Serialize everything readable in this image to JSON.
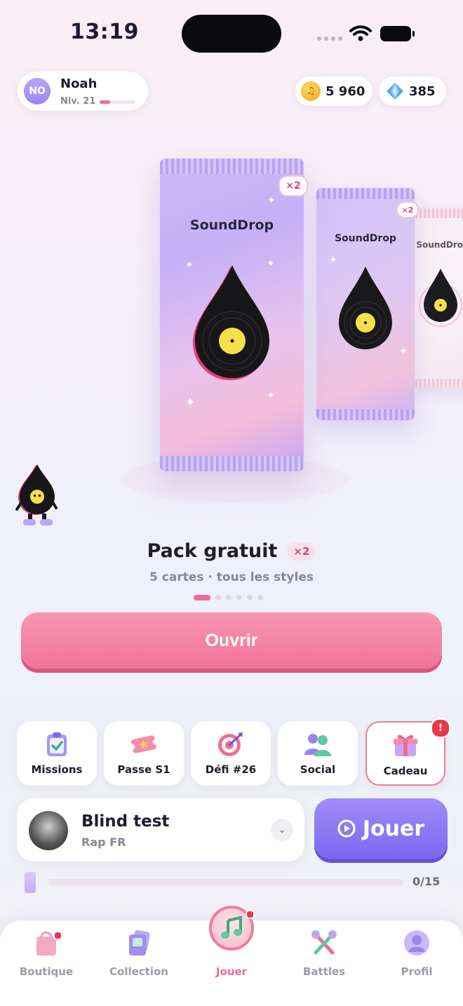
{
  "status": {
    "time": "13:19"
  },
  "user": {
    "initials": "NO",
    "name": "Noah",
    "level": "Niv. 21",
    "xp_fraction": 0.3
  },
  "currency": {
    "coins": "5 960",
    "gems": "385"
  },
  "pack": {
    "brand": "SoundDrop",
    "multiplier": "×2",
    "title": "Pack gratuit",
    "subtitle": "5 cartes · tous les styles",
    "pages": 6,
    "active_page": 0,
    "open_label": "Ouvrir"
  },
  "tiles": [
    {
      "label": "Missions",
      "icon": "clipboard-check-icon"
    },
    {
      "label": "Passe S1",
      "icon": "ticket-icon"
    },
    {
      "label": "Défi #26",
      "icon": "target-icon"
    },
    {
      "label": "Social",
      "icon": "people-icon"
    },
    {
      "label": "Cadeau",
      "icon": "gift-icon",
      "alert": "!"
    }
  ],
  "blind_test": {
    "title": "Blind test",
    "subtitle": "Rap FR",
    "play_label": "Jouer"
  },
  "progress": {
    "text": "0/15",
    "fraction": 0
  },
  "nav": [
    {
      "label": "Boutique",
      "icon": "shopping-bag-icon"
    },
    {
      "label": "Collection",
      "icon": "cards-icon"
    },
    {
      "label": "Jouer",
      "icon": "music-note-icon"
    },
    {
      "label": "Battles",
      "icon": "crossed-microphones-icon"
    },
    {
      "label": "Profil",
      "icon": "profile-icon"
    }
  ],
  "colors": {
    "accent_pink": "#f07498",
    "accent_purple": "#7d67ef"
  }
}
